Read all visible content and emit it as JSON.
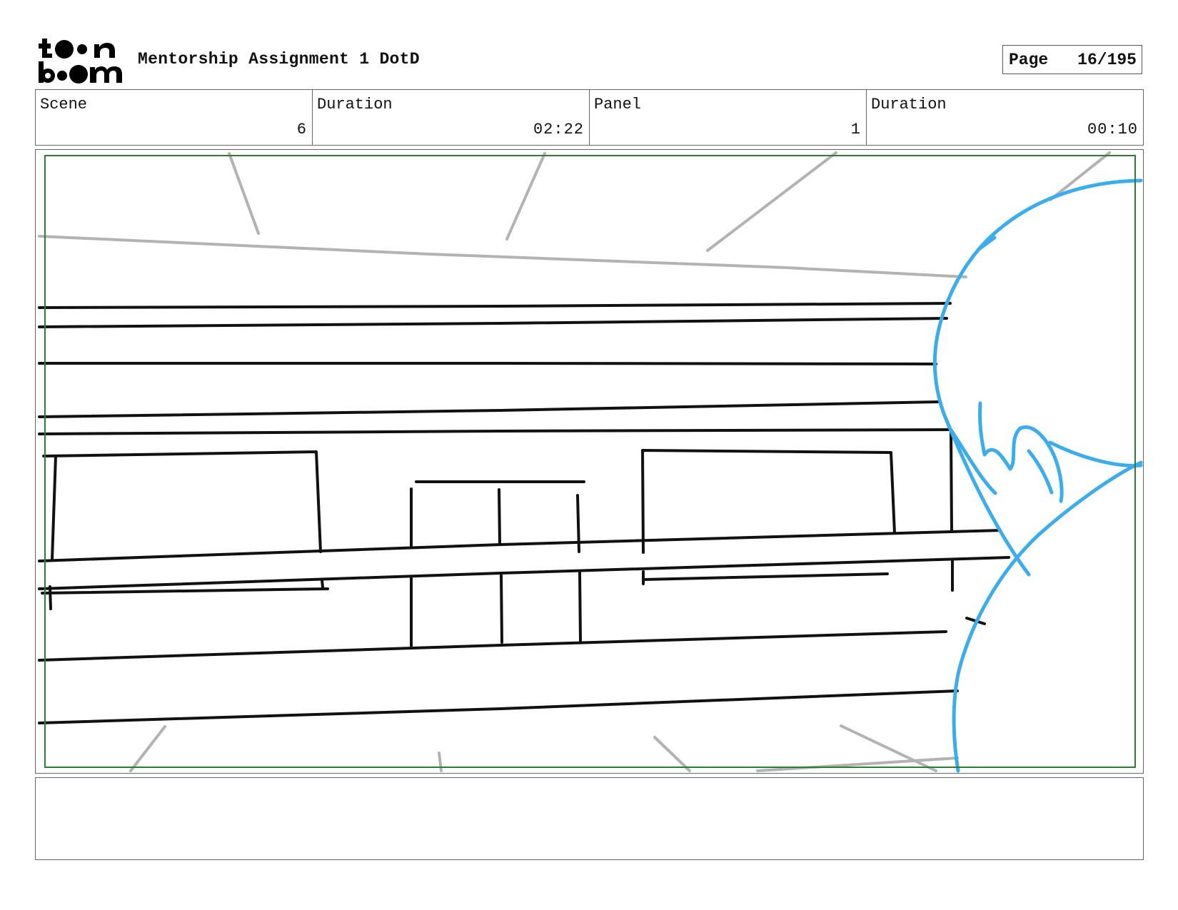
{
  "header": {
    "logo_text": "toon boom",
    "title": "Mentorship Assignment 1 DotD",
    "page_label": "Page",
    "page_number": "16/195"
  },
  "info": {
    "scene_label": "Scene",
    "scene_value": "6",
    "scene_duration_label": "Duration",
    "scene_duration_value": "02:22",
    "panel_label": "Panel",
    "panel_value": "1",
    "panel_duration_label": "Duration",
    "panel_duration_value": "00:10"
  },
  "panel": {
    "drawing": "sketch",
    "colors": {
      "ink": "#111111",
      "construction_lines": "#b3b3b3",
      "character_lines": "#3badec",
      "safe_frame": "#2e7d32"
    }
  },
  "notes": {
    "text": ""
  }
}
